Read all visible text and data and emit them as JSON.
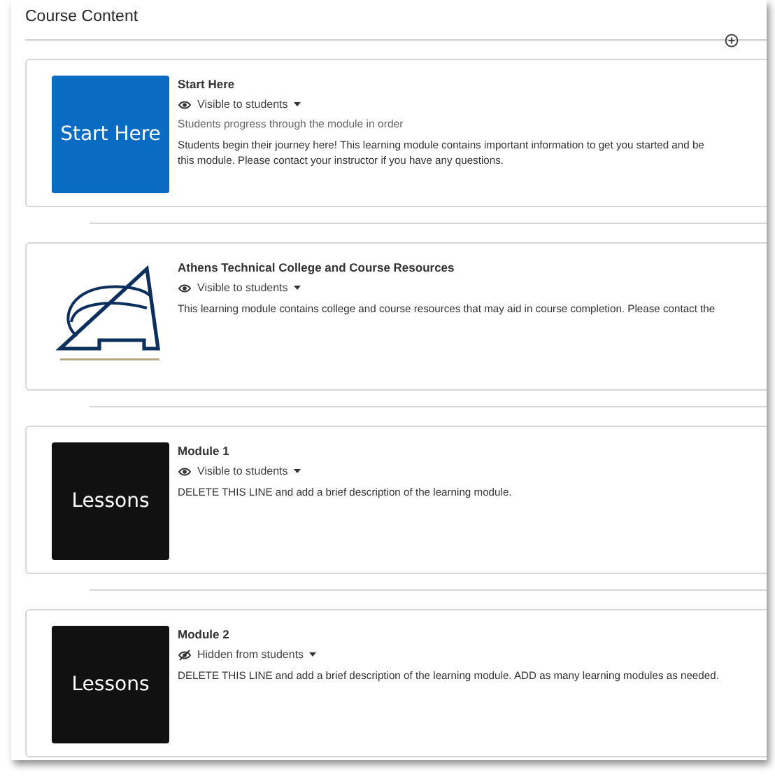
{
  "heading": "Course Content",
  "modules": [
    {
      "thumbnail": {
        "kind": "tile",
        "color": "#0a6bc2",
        "text": "Start Here"
      },
      "title": "Start Here",
      "visibility": {
        "hidden": false,
        "label": "Visible to students"
      },
      "subtitle": "Students progress through the module in order",
      "description": "Students begin their journey here! This learning module contains important information to get you started and be\nthis module. Please contact your instructor if you have any questions."
    },
    {
      "thumbnail": {
        "kind": "logo"
      },
      "title": "Athens Technical College and Course Resources",
      "visibility": {
        "hidden": false,
        "label": "Visible to students"
      },
      "description": "This learning module contains college and course resources that may aid in course completion. Please contact the"
    },
    {
      "thumbnail": {
        "kind": "tile",
        "color": "#111111",
        "text": "Lessons"
      },
      "title": "Module 1",
      "visibility": {
        "hidden": false,
        "label": "Visible to students"
      },
      "description": "DELETE THIS LINE and add a brief description of the learning module."
    },
    {
      "thumbnail": {
        "kind": "tile",
        "color": "#111111",
        "text": "Lessons"
      },
      "title": "Module 2",
      "visibility": {
        "hidden": true,
        "label": "Hidden from students"
      },
      "description": "DELETE THIS LINE and add a brief description of the learning module. ADD as many learning modules as needed."
    }
  ]
}
